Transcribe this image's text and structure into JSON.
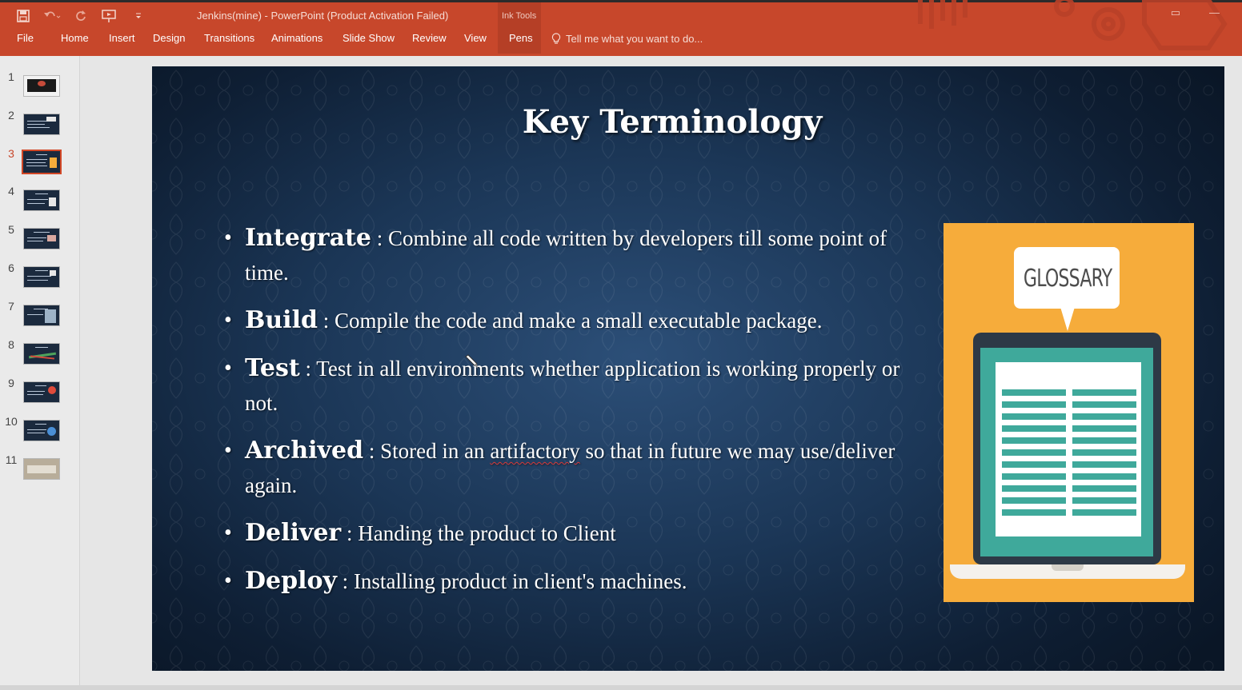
{
  "window": {
    "title": "Jenkins(mine) - PowerPoint (Product Activation Failed)",
    "contextual_group": "Ink Tools",
    "accent_color": "#c7472b"
  },
  "quick_access": [
    {
      "name": "save-icon"
    },
    {
      "name": "undo-icon"
    },
    {
      "name": "redo-icon"
    },
    {
      "name": "start-from-beginning-icon"
    },
    {
      "name": "customize-quick-access-icon"
    }
  ],
  "tabs": [
    {
      "label": "File"
    },
    {
      "label": "Home"
    },
    {
      "label": "Insert"
    },
    {
      "label": "Design"
    },
    {
      "label": "Transitions"
    },
    {
      "label": "Animations"
    },
    {
      "label": "Slide Show"
    },
    {
      "label": "Review"
    },
    {
      "label": "View"
    },
    {
      "label": "Pens",
      "active": true
    }
  ],
  "tell_me": {
    "placeholder": "Tell me what you want to do...",
    "icon": "lightbulb-icon"
  },
  "thumbnails": [
    {
      "number": "1"
    },
    {
      "number": "2"
    },
    {
      "number": "3",
      "active": true
    },
    {
      "number": "4"
    },
    {
      "number": "5"
    },
    {
      "number": "6"
    },
    {
      "number": "7"
    },
    {
      "number": "8"
    },
    {
      "number": "9"
    },
    {
      "number": "10"
    },
    {
      "number": "11"
    }
  ],
  "slide": {
    "title": "Key Terminology",
    "bullets": [
      {
        "term": "Integrate",
        "sep": " : ",
        "text": "Combine all code written by developers till some point of time."
      },
      {
        "term": "Build",
        "sep": " : ",
        "text": "Compile the code and make a small executable package."
      },
      {
        "term": "Test",
        "sep": " : ",
        "text": "Test in all environments whether application is working properly or not."
      },
      {
        "term": "Archived",
        "sep": " : ",
        "text_before": "Stored in an ",
        "text_flagged": "artifactory",
        "text_after": " so that in future we may use/deliver again."
      },
      {
        "term": "Deliver",
        "sep": " : ",
        "text": "Handing the product to Client"
      },
      {
        "term": "Deploy",
        "sep": " : ",
        "text": "Installing product in client's machines."
      }
    ],
    "image": {
      "label": "GLOSSARY",
      "background": "#f6ac3b",
      "screen_color": "#3fa99b"
    },
    "cursor_icon": "pen-cursor-icon"
  }
}
